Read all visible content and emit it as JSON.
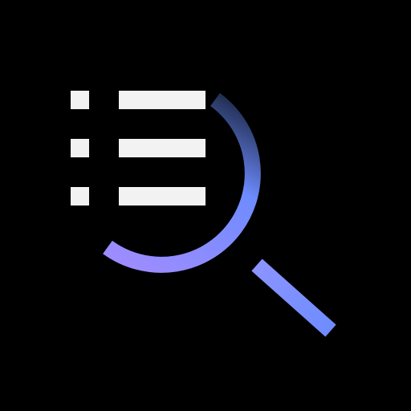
{
  "logo": {
    "icon": "list-search-icon",
    "colors": {
      "background": "#000000",
      "list_marks": "#F2F2F2",
      "ring_gradient_start": "#1E2A4A",
      "ring_gradient_mid": "#6E8CFF",
      "ring_gradient_end": "#A58CFF",
      "handle": "#7E98FF"
    }
  }
}
